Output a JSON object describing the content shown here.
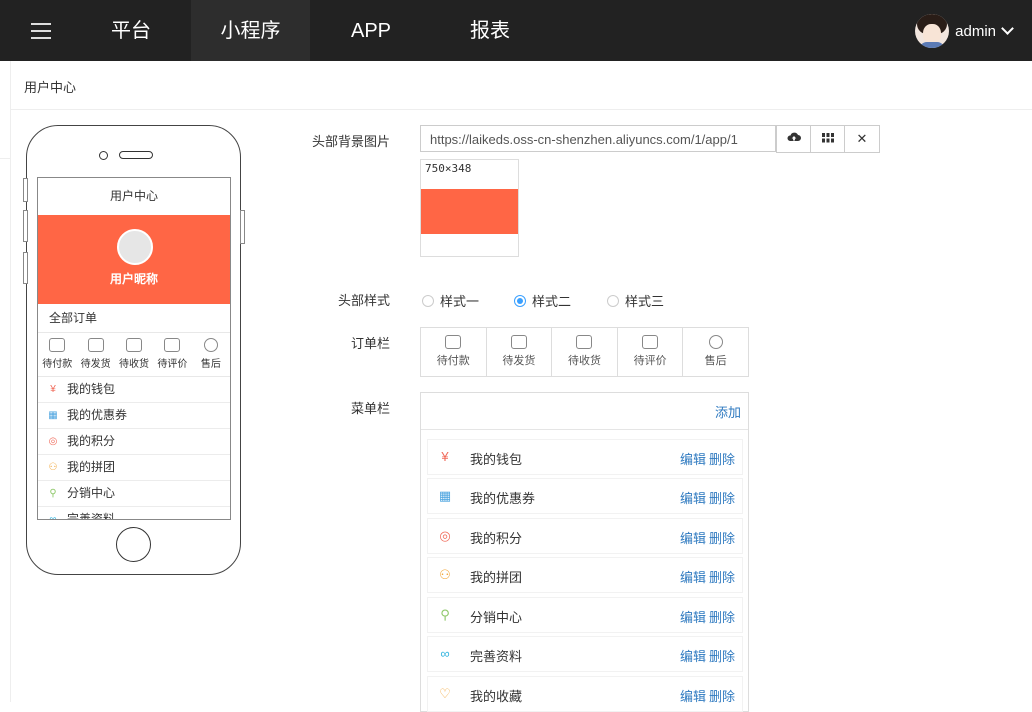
{
  "nav": {
    "items": [
      "平台",
      "小程序",
      "APP",
      "报表"
    ],
    "active": "小程序",
    "user": "admin"
  },
  "breadcrumb": "用户中心",
  "phone": {
    "title": "用户中心",
    "nickname": "用户昵称",
    "orders_title": "全部订单",
    "orders": [
      "待付款",
      "待发货",
      "待收货",
      "待评价",
      "售后"
    ],
    "menu": [
      "我的钱包",
      "我的优惠券",
      "我的积分",
      "我的拼团",
      "分销中心",
      "完善资料"
    ]
  },
  "form": {
    "bg_label": "头部背景图片",
    "bg_url": "https://laikeds.oss-cn-shenzhen.aliyuncs.com/1/app/1",
    "thumb_size": "750×348",
    "header_color": "#ff6645",
    "style_label": "头部样式",
    "styles": [
      "样式一",
      "样式二",
      "样式三"
    ],
    "selected_style": "样式二",
    "order_label": "订单栏",
    "orders": [
      "待付款",
      "待发货",
      "待收货",
      "待评价",
      "售后"
    ],
    "menu_label": "菜单栏",
    "add_label": "添加",
    "edit_label": "编辑",
    "delete_label": "删除",
    "menu_items": [
      {
        "name": "我的钱包",
        "icon": "wallet-icon",
        "color": "#f06b5b"
      },
      {
        "name": "我的优惠券",
        "icon": "coupon-icon",
        "color": "#4aa3df"
      },
      {
        "name": "我的积分",
        "icon": "points-icon",
        "color": "#f06b5b"
      },
      {
        "name": "我的拼团",
        "icon": "group-icon",
        "color": "#f2a73b"
      },
      {
        "name": "分销中心",
        "icon": "distribution-icon",
        "color": "#8fc86a"
      },
      {
        "name": "完善资料",
        "icon": "link-icon",
        "color": "#36b6e0"
      },
      {
        "name": "我的收藏",
        "icon": "heart-icon",
        "color": "#f2a73b"
      }
    ]
  }
}
